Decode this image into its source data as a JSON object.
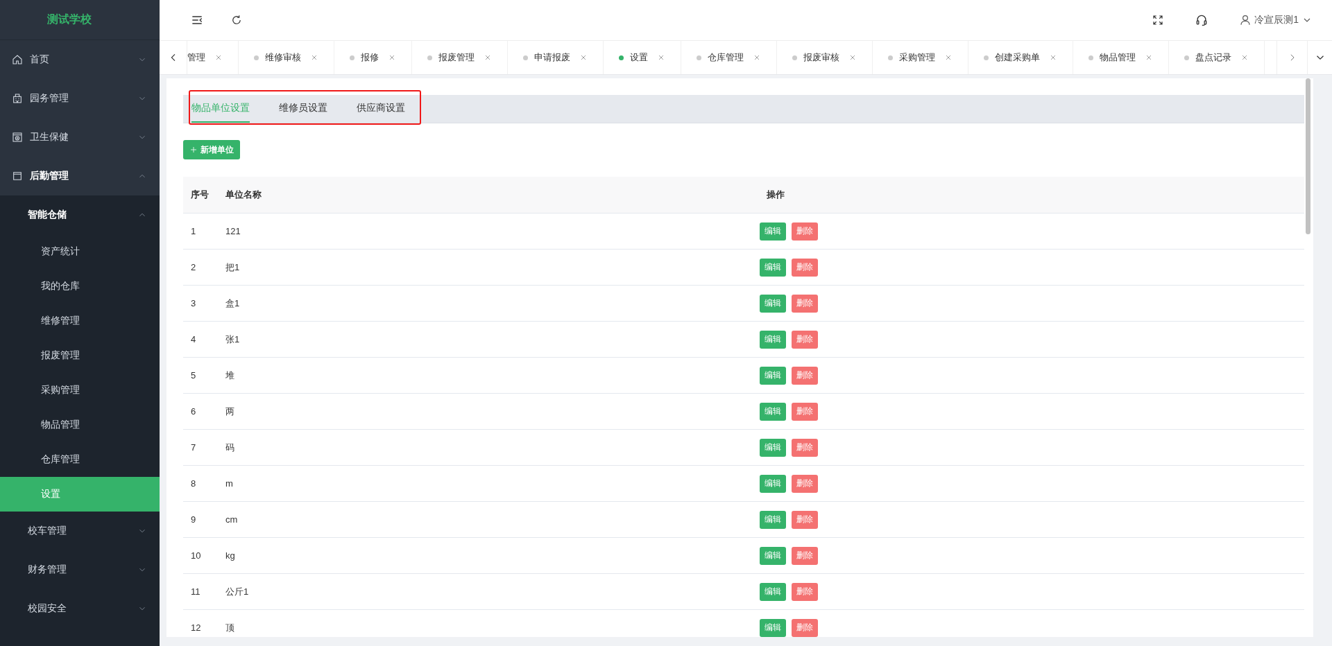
{
  "logo": "测试学校",
  "sidebar": {
    "items": [
      {
        "label": "首页",
        "expanded": false
      },
      {
        "label": "园务管理",
        "expanded": false
      },
      {
        "label": "卫生保健",
        "expanded": false
      },
      {
        "label": "后勤管理",
        "expanded": true,
        "children": [
          {
            "label": "智能仓储",
            "expanded": true,
            "children": [
              {
                "label": "资产统计",
                "selected": false
              },
              {
                "label": "我的仓库",
                "selected": false
              },
              {
                "label": "维修管理",
                "selected": false
              },
              {
                "label": "报废管理",
                "selected": false
              },
              {
                "label": "采购管理",
                "selected": false
              },
              {
                "label": "物品管理",
                "selected": false
              },
              {
                "label": "仓库管理",
                "selected": false
              },
              {
                "label": "设置",
                "selected": true
              }
            ]
          },
          {
            "label": "校车管理",
            "expanded": false
          },
          {
            "label": "财务管理",
            "expanded": false
          },
          {
            "label": "校园安全",
            "expanded": false
          }
        ]
      }
    ]
  },
  "header": {
    "user": "冷宣辰测1"
  },
  "page_tabs": [
    {
      "label": "管理"
    },
    {
      "label": "维修审核",
      "selected": false
    },
    {
      "label": "报修",
      "selected": false
    },
    {
      "label": "报废管理",
      "selected": false
    },
    {
      "label": "申请报废",
      "selected": false
    },
    {
      "label": "设置",
      "selected": true
    },
    {
      "label": "仓库管理",
      "selected": false
    },
    {
      "label": "报废审核",
      "selected": false
    },
    {
      "label": "采购管理",
      "selected": false
    },
    {
      "label": "创建采购单",
      "selected": false
    },
    {
      "label": "物品管理",
      "selected": false
    },
    {
      "label": "盘点记录",
      "selected": false
    }
  ],
  "sub_tabs": {
    "highlighted": true,
    "items": [
      {
        "label": "物品单位设置",
        "selected": true
      },
      {
        "label": "维修员设置",
        "selected": false
      },
      {
        "label": "供应商设置",
        "selected": false
      }
    ]
  },
  "add_button": "新增单位",
  "table": {
    "columns": [
      "序号",
      "单位名称",
      "操作"
    ],
    "rows": [
      {
        "index": "1",
        "name": "121",
        "actions": [
          {
            "label": "编辑",
            "kind": "edit"
          },
          {
            "label": "删除",
            "kind": "delete"
          }
        ]
      },
      {
        "index": "2",
        "name": "把1",
        "actions": [
          {
            "label": "编辑",
            "kind": "edit"
          },
          {
            "label": "删除",
            "kind": "delete"
          }
        ]
      },
      {
        "index": "3",
        "name": "盒1",
        "actions": [
          {
            "label": "编辑",
            "kind": "edit"
          },
          {
            "label": "删除",
            "kind": "delete"
          }
        ]
      },
      {
        "index": "4",
        "name": "张1",
        "actions": [
          {
            "label": "编辑",
            "kind": "edit"
          },
          {
            "label": "删除",
            "kind": "delete"
          }
        ]
      },
      {
        "index": "5",
        "name": "堆",
        "actions": [
          {
            "label": "编辑",
            "kind": "edit"
          },
          {
            "label": "删除",
            "kind": "delete"
          }
        ]
      },
      {
        "index": "6",
        "name": "两",
        "actions": [
          {
            "label": "编辑",
            "kind": "edit"
          },
          {
            "label": "删除",
            "kind": "delete"
          }
        ]
      },
      {
        "index": "7",
        "name": "码",
        "actions": [
          {
            "label": "编辑",
            "kind": "edit"
          },
          {
            "label": "删除",
            "kind": "delete"
          }
        ]
      },
      {
        "index": "8",
        "name": "m",
        "actions": [
          {
            "label": "编辑",
            "kind": "edit"
          },
          {
            "label": "删除",
            "kind": "delete"
          }
        ]
      },
      {
        "index": "9",
        "name": "cm",
        "actions": [
          {
            "label": "编辑",
            "kind": "edit"
          },
          {
            "label": "删除",
            "kind": "delete"
          }
        ]
      },
      {
        "index": "10",
        "name": "kg",
        "actions": [
          {
            "label": "编辑",
            "kind": "edit"
          },
          {
            "label": "删除",
            "kind": "delete"
          }
        ]
      },
      {
        "index": "11",
        "name": "公斤1",
        "actions": [
          {
            "label": "编辑",
            "kind": "edit"
          },
          {
            "label": "删除",
            "kind": "delete"
          }
        ]
      },
      {
        "index": "12",
        "name": "顶",
        "actions": [
          {
            "label": "编辑",
            "kind": "edit"
          },
          {
            "label": "删除",
            "kind": "delete"
          }
        ]
      }
    ]
  }
}
